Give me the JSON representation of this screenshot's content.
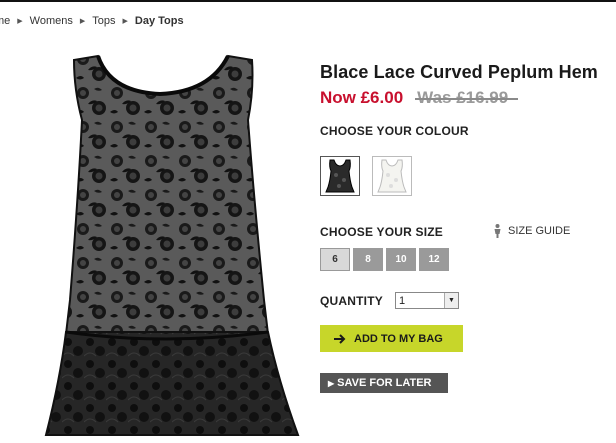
{
  "breadcrumb": {
    "items": [
      "me",
      "Womens",
      "Tops"
    ],
    "current": "Day Tops"
  },
  "product": {
    "title": "Blace Lace Curved Peplum Hem",
    "price_now": "Now £6.00",
    "price_was": "Was £16.99"
  },
  "colour": {
    "label": "CHOOSE YOUR COLOUR",
    "options": [
      "black",
      "white"
    ],
    "selected": "black"
  },
  "size": {
    "label": "CHOOSE YOUR SIZE",
    "guide_label": "SIZE GUIDE",
    "options": [
      "6",
      "8",
      "10",
      "12"
    ],
    "selected": "6"
  },
  "quantity": {
    "label": "QUANTITY",
    "value": "1"
  },
  "actions": {
    "add_to_bag": "ADD TO MY BAG",
    "save_for_later": "SAVE FOR LATER"
  },
  "colors": {
    "price_now": "#c8102e",
    "add_to_bag_bg": "#c7d62a",
    "save_bg": "#555555"
  }
}
